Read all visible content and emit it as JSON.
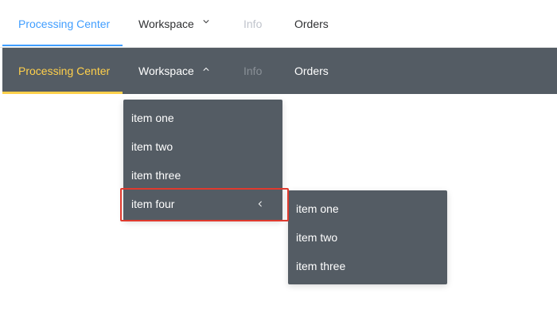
{
  "light_menu": {
    "items": [
      {
        "label": "Processing Center"
      },
      {
        "label": "Workspace"
      },
      {
        "label": "Info"
      },
      {
        "label": "Orders"
      }
    ]
  },
  "dark_menu": {
    "items": [
      {
        "label": "Processing Center"
      },
      {
        "label": "Workspace"
      },
      {
        "label": "Info"
      },
      {
        "label": "Orders"
      }
    ]
  },
  "workspace_dropdown": {
    "items": [
      {
        "label": "item one"
      },
      {
        "label": "item two"
      },
      {
        "label": "item three"
      },
      {
        "label": "item four"
      }
    ]
  },
  "item_four_submenu": {
    "items": [
      {
        "label": "item one"
      },
      {
        "label": "item two"
      },
      {
        "label": "item three"
      }
    ]
  },
  "colors": {
    "light_active": "#409eff",
    "dark_bg": "#545c64",
    "dark_active": "#ffd04b",
    "highlight": "#e03a2e",
    "disabled_light": "#c0c4cc"
  },
  "icons": {
    "workspace_light_arrow": "chevron-down-icon",
    "workspace_dark_arrow": "chevron-up-icon",
    "item_four_arrow": "chevron-left-icon"
  }
}
